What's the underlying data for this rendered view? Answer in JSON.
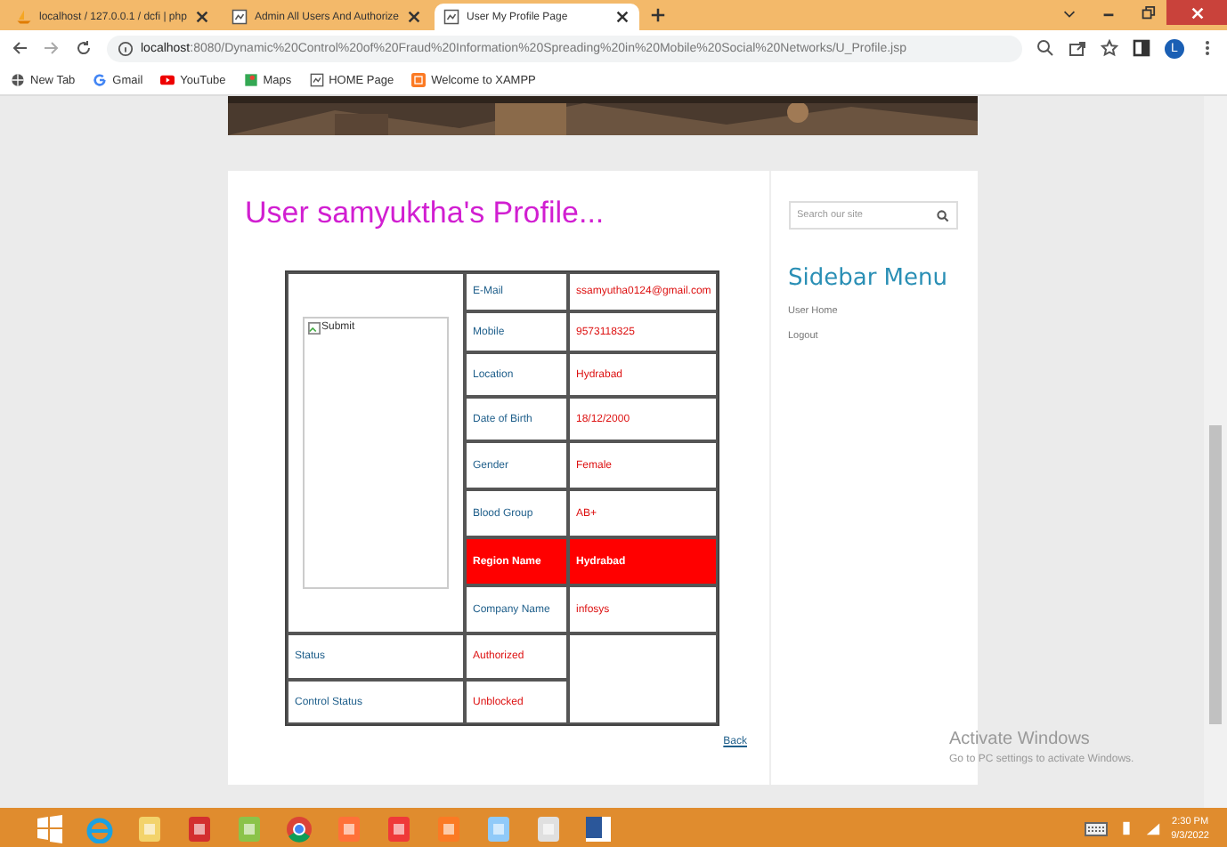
{
  "browser": {
    "tabs": [
      {
        "title": "localhost / 127.0.0.1 / dcfi | php",
        "selected": false,
        "kind": "sail"
      },
      {
        "title": "Admin All Users And Authorize",
        "selected": false,
        "kind": "page"
      },
      {
        "title": "User My Profile Page",
        "selected": true,
        "kind": "page"
      }
    ],
    "url_host": "localhost",
    "url_path": ":8080/Dynamic%20Control%20of%20Fraud%20Information%20Spreading%20in%20Mobile%20Social%20Networks/U_Profile.jsp",
    "profile_initial": "L",
    "bookmarks": [
      {
        "label": "New Tab",
        "kind": "globe"
      },
      {
        "label": "Gmail",
        "kind": "google"
      },
      {
        "label": "YouTube",
        "kind": "youtube"
      },
      {
        "label": "Maps",
        "kind": "maps"
      },
      {
        "label": "HOME Page",
        "kind": "page"
      },
      {
        "label": "Welcome to XAMPP",
        "kind": "xampp"
      }
    ]
  },
  "page": {
    "heading": "User samyuktha's Profile...",
    "image_alt": "Submit",
    "details": [
      {
        "label": "E-Mail",
        "value": "ssamyutha0124@gmail.com",
        "highlighted": false
      },
      {
        "label": "Mobile",
        "value": "9573118325",
        "highlighted": false
      },
      {
        "label": "Location",
        "value": "Hydrabad",
        "highlighted": false
      },
      {
        "label": "Date of Birth",
        "value": "18/12/2000",
        "highlighted": false
      },
      {
        "label": "Gender",
        "value": "Female",
        "highlighted": false
      },
      {
        "label": "Blood Group",
        "value": "AB+",
        "highlighted": false
      },
      {
        "label": "Region Name",
        "value": "Hydrabad",
        "highlighted": true
      },
      {
        "label": "Company Name",
        "value": "infosys",
        "highlighted": false
      }
    ],
    "status_rows": [
      {
        "label": "Status",
        "value": "Authorized"
      },
      {
        "label": "Control Status",
        "value": "Unblocked"
      }
    ],
    "back_link": "Back"
  },
  "sidebar": {
    "search_placeholder": "Search our site",
    "title": "Sidebar Menu",
    "items": [
      {
        "label": "User Home"
      },
      {
        "label": "Logout"
      }
    ]
  },
  "activation_notice": {
    "title": "Activate Windows",
    "text": "Go to PC settings to activate Windows."
  },
  "taskbar": {
    "apps": [
      {
        "kind": "start"
      },
      {
        "kind": "ie"
      },
      {
        "kind": "files"
      },
      {
        "kind": "pdf"
      },
      {
        "kind": "leaf"
      },
      {
        "kind": "chrome"
      },
      {
        "kind": "firefox"
      },
      {
        "kind": "vivaldi"
      },
      {
        "kind": "xampp"
      },
      {
        "kind": "drive"
      },
      {
        "kind": "tool"
      },
      {
        "kind": "word"
      }
    ],
    "time": "2:30 PM",
    "date": "9/3/2022"
  }
}
